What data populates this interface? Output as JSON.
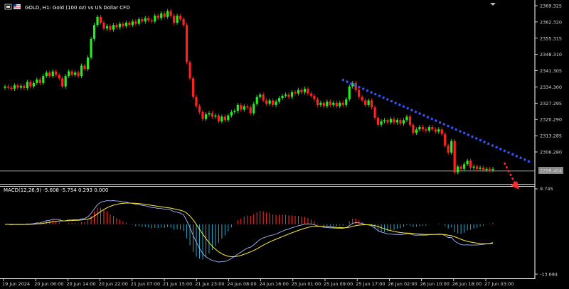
{
  "window": {
    "title": "GOLD, H1:  Gold (100 oz) vs US Dollar CFD",
    "macd_label": "MACD(12,26,9) -5.608 -5.754 0.293 0.000"
  },
  "price_axis": {
    "ticks": [
      "2369.325",
      "2362.320",
      "2355.315",
      "2348.310",
      "2341.305",
      "2334.300",
      "2327.295",
      "2320.290",
      "2313.285",
      "2306.280"
    ],
    "current_price": "2298.454"
  },
  "macd_axis": {
    "top": "9.745",
    "bottom": "-13.684"
  },
  "time_axis": {
    "ticks": [
      "19 Jun 2024",
      "20 Jun 06:00",
      "20 Jun 14:00",
      "20 Jun 22:00",
      "21 Jun 07:00",
      "21 Jun 15:00",
      "21 Jun 23:00",
      "24 Jun 08:00",
      "24 Jun 16:00",
      "25 Jun 01:00",
      "25 Jun 09:00",
      "25 Jun 17:00",
      "26 Jun 02:00",
      "26 Jun 10:00",
      "26 Jun 18:00",
      "27 Jun 03:00"
    ]
  },
  "colors": {
    "background": "#000000",
    "bull": "#22ee22",
    "bear": "#ff2222",
    "trendline": "#3355ff",
    "projection": "#ff2a2a",
    "macd_hist_pos": "#ff3333",
    "macd_hist_neg": "#2aa8c8",
    "macd_line": "#a8b8ff",
    "signal_line": "#ffee33"
  },
  "chart_data": [
    {
      "type": "candlestick",
      "title": "GOLD, H1:  Gold (100 oz) vs US Dollar CFD",
      "ylim": [
        2296.0,
        2372.5
      ],
      "closes": [
        2334.5,
        2334.0,
        2333.5,
        2335.0,
        2334.0,
        2334.8,
        2333.8,
        2336.5,
        2334.5,
        2336.0,
        2337.5,
        2336.0,
        2339.0,
        2340.5,
        2339.0,
        2341.0,
        2339.5,
        2338.0,
        2334.5,
        2339.0,
        2341.0,
        2339.5,
        2340.5,
        2339.0,
        2343.5,
        2342.0,
        2347.0,
        2355.0,
        2361.0,
        2364.5,
        2362.0,
        2359.5,
        2360.5,
        2359.0,
        2361.0,
        2360.0,
        2361.5,
        2360.5,
        2362.0,
        2361.0,
        2362.5,
        2361.5,
        2363.5,
        2362.5,
        2364.0,
        2363.0,
        2362.5,
        2365.0,
        2364.0,
        2366.0,
        2364.5,
        2367.0,
        2365.0,
        2362.0,
        2365.0,
        2363.5,
        2361.0,
        2345.0,
        2338.0,
        2330.0,
        2326.0,
        2323.5,
        2320.5,
        2322.5,
        2323.0,
        2321.5,
        2322.0,
        2319.5,
        2321.5,
        2320.0,
        2322.0,
        2323.5,
        2324.0,
        2326.5,
        2324.5,
        2326.0,
        2325.5,
        2323.0,
        2327.0,
        2330.0,
        2331.0,
        2328.5,
        2327.0,
        2328.5,
        2326.5,
        2328.0,
        2329.5,
        2330.5,
        2331.0,
        2330.0,
        2332.0,
        2331.5,
        2333.0,
        2332.0,
        2333.5,
        2331.5,
        2330.5,
        2329.0,
        2326.5,
        2327.5,
        2326.0,
        2328.0,
        2326.5,
        2327.5,
        2326.0,
        2327.5,
        2326.5,
        2329.0,
        2334.5,
        2336.0,
        2333.0,
        2330.0,
        2328.5,
        2326.5,
        2328.5,
        2325.5,
        2321.0,
        2318.0,
        2319.5,
        2320.0,
        2319.0,
        2320.5,
        2319.0,
        2320.0,
        2318.5,
        2320.0,
        2321.5,
        2318.0,
        2314.5,
        2316.0,
        2317.0,
        2316.0,
        2315.5,
        2317.0,
        2316.0,
        2315.0,
        2316.0,
        2314.0,
        2309.0,
        2306.0,
        2311.0,
        2297.5,
        2300.0,
        2299.0,
        2301.0,
        2302.5,
        2299.5,
        2300.0,
        2299.0,
        2299.5,
        2298.5,
        2299.0,
        2298.5,
        2299.0
      ],
      "current_price": 2298.454
    },
    {
      "type": "macd",
      "title": "MACD(12,26,9) -5.608 -5.754 0.293 0.000",
      "ylim": [
        -13.684,
        9.745
      ],
      "macd_last": -5.608,
      "signal_last": -5.754,
      "osma_last": 0.293
    }
  ],
  "annotations": {
    "trendline": {
      "from_price": 2336.0,
      "to_price": 2304.0,
      "label": ""
    },
    "projection_arrow": {
      "direction": "down-right",
      "label": ""
    }
  }
}
